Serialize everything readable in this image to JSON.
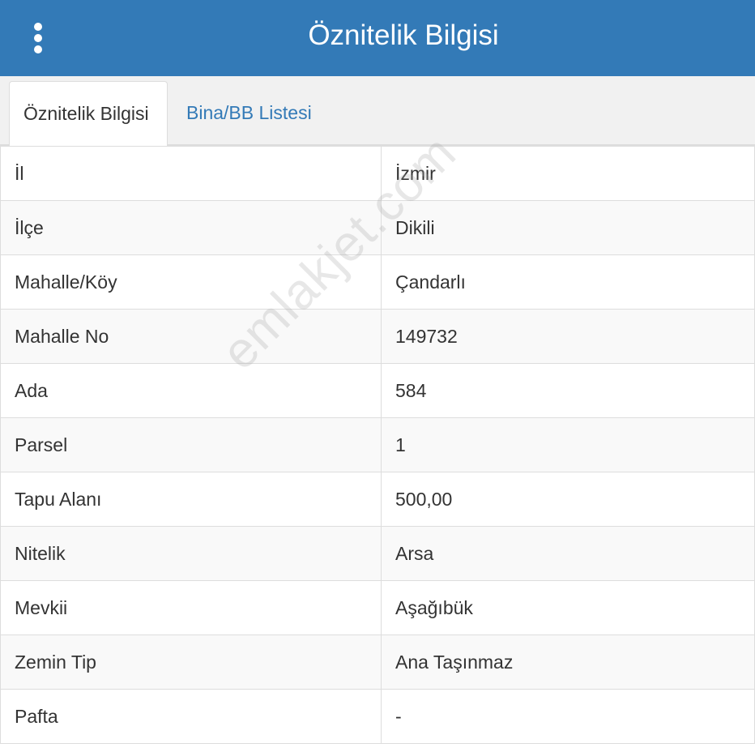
{
  "header": {
    "title": "Öznitelik Bilgisi",
    "menu_icon": "more-vertical-icon",
    "background_color": "#337ab7"
  },
  "tabs": [
    {
      "label": "Öznitelik Bilgisi",
      "active": true
    },
    {
      "label": "Bina/BB Listesi",
      "active": false
    }
  ],
  "attributes": [
    {
      "key": "İl",
      "value": "İzmir"
    },
    {
      "key": "İlçe",
      "value": "Dikili"
    },
    {
      "key": "Mahalle/Köy",
      "value": "Çandarlı"
    },
    {
      "key": "Mahalle No",
      "value": "149732"
    },
    {
      "key": "Ada",
      "value": "584"
    },
    {
      "key": "Parsel",
      "value": "1"
    },
    {
      "key": "Tapu Alanı",
      "value": "500,00"
    },
    {
      "key": "Nitelik",
      "value": "Arsa"
    },
    {
      "key": "Mevkii",
      "value": "Aşağıbük"
    },
    {
      "key": "Zemin Tip",
      "value": "Ana Taşınmaz"
    },
    {
      "key": "Pafta",
      "value": "-"
    }
  ],
  "watermark": "emlakjet.com"
}
